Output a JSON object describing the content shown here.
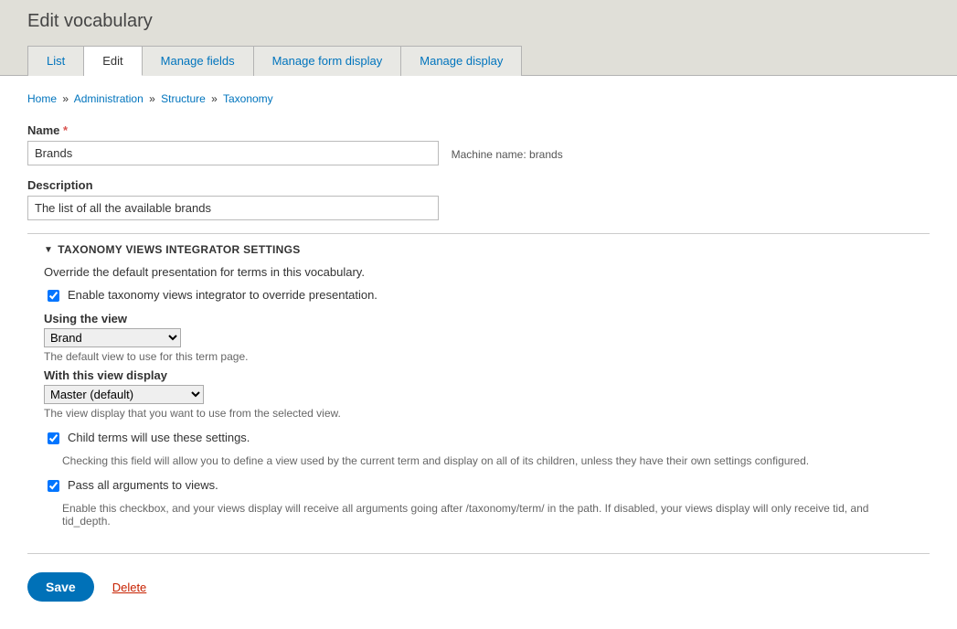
{
  "page": {
    "title": "Edit vocabulary"
  },
  "tabs": {
    "list": "List",
    "edit": "Edit",
    "manage_fields": "Manage fields",
    "manage_form_display": "Manage form display",
    "manage_display": "Manage display"
  },
  "breadcrumb": {
    "home": "Home",
    "admin": "Administration",
    "structure": "Structure",
    "taxonomy": "Taxonomy"
  },
  "form": {
    "name_label": "Name",
    "name_value": "Brands",
    "machine_name_label": "Machine name:",
    "machine_name_value": "brands",
    "description_label": "Description",
    "description_value": "The list of all the available brands"
  },
  "tvi": {
    "legend": "TAXONOMY VIEWS INTEGRATOR SETTINGS",
    "intro": "Override the default presentation for terms in this vocabulary.",
    "enable_label": "Enable taxonomy views integrator to override presentation.",
    "using_view_label": "Using the view",
    "using_view_value": "Brand",
    "using_view_desc": "The default view to use for this term page.",
    "display_label": "With this view display",
    "display_value": "Master (default)",
    "display_desc": "The view display that you want to use from the selected view.",
    "child_label": "Child terms will use these settings.",
    "child_desc": "Checking this field will allow you to define a view used by the current term and display on all of its children, unless they have their own settings configured.",
    "pass_args_label": "Pass all arguments to views.",
    "pass_args_desc": "Enable this checkbox, and your views display will receive all arguments going after /taxonomy/term/ in the path. If disabled, your views display will only receive tid, and tid_depth."
  },
  "actions": {
    "save": "Save",
    "delete": "Delete"
  }
}
